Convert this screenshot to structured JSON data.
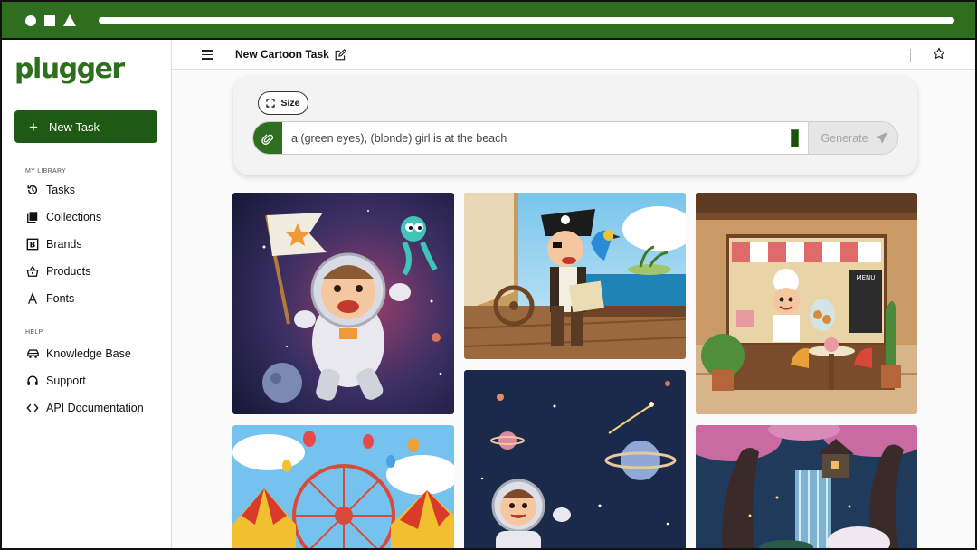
{
  "app": {
    "logo_text": "plugger",
    "brand_color": "#2e6e1e",
    "new_task_label": "New Task"
  },
  "browser": {
    "icons": [
      "circle-icon",
      "square-icon",
      "triangle-icon"
    ]
  },
  "sidebar": {
    "library_label": "MY LIBRARY",
    "library_items": [
      {
        "label": "Tasks",
        "icon": "history-icon"
      },
      {
        "label": "Collections",
        "icon": "collections-icon"
      },
      {
        "label": "Brands",
        "icon": "brands-icon"
      },
      {
        "label": "Products",
        "icon": "basket-icon"
      },
      {
        "label": "Fonts",
        "icon": "font-icon"
      }
    ],
    "help_label": "HELP",
    "help_items": [
      {
        "label": "Knowledge Base",
        "icon": "car-icon"
      },
      {
        "label": "Support",
        "icon": "headset-icon"
      },
      {
        "label": "API Documentation",
        "icon": "code-icon"
      }
    ]
  },
  "header": {
    "task_title": "New Cartoon Task"
  },
  "prompt": {
    "size_label": "Size",
    "value": "a (green eyes), (blonde) girl is at the beach",
    "generate_label": "Generate"
  },
  "gallery": [
    {
      "subject": "astronaut boy with flag and alien in space"
    },
    {
      "subject": "pirate with parrot on ship deck"
    },
    {
      "subject": "chef in bakery cafe"
    },
    {
      "subject": "carnival with ferris wheel and balloons"
    },
    {
      "subject": "astronaut child with planets"
    },
    {
      "subject": "enchanted forest waterfall"
    }
  ]
}
